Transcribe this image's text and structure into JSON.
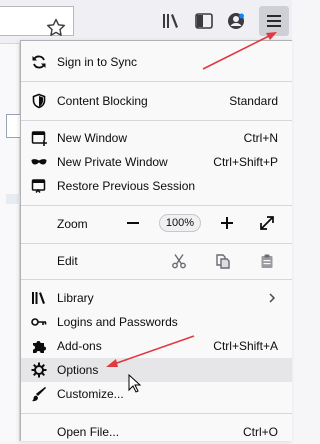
{
  "menu": {
    "sync": {
      "label": "Sign in to Sync"
    },
    "content_blocking": {
      "label": "Content Blocking",
      "value": "Standard"
    },
    "new_window": {
      "label": "New Window",
      "shortcut": "Ctrl+N"
    },
    "private_window": {
      "label": "New Private Window",
      "shortcut": "Ctrl+Shift+P"
    },
    "restore": {
      "label": "Restore Previous Session"
    },
    "zoom": {
      "label": "Zoom",
      "minus": "−",
      "value": "100%",
      "plus": "+"
    },
    "edit": {
      "label": "Edit"
    },
    "library": {
      "label": "Library"
    },
    "logins": {
      "label": "Logins and Passwords"
    },
    "addons": {
      "label": "Add-ons",
      "shortcut": "Ctrl+Shift+A"
    },
    "options": {
      "label": "Options"
    },
    "customize": {
      "label": "Customize..."
    },
    "open_file": {
      "label": "Open File...",
      "shortcut": "Ctrl+O"
    }
  },
  "colors": {
    "annotation_arrow": "#e0393e"
  }
}
